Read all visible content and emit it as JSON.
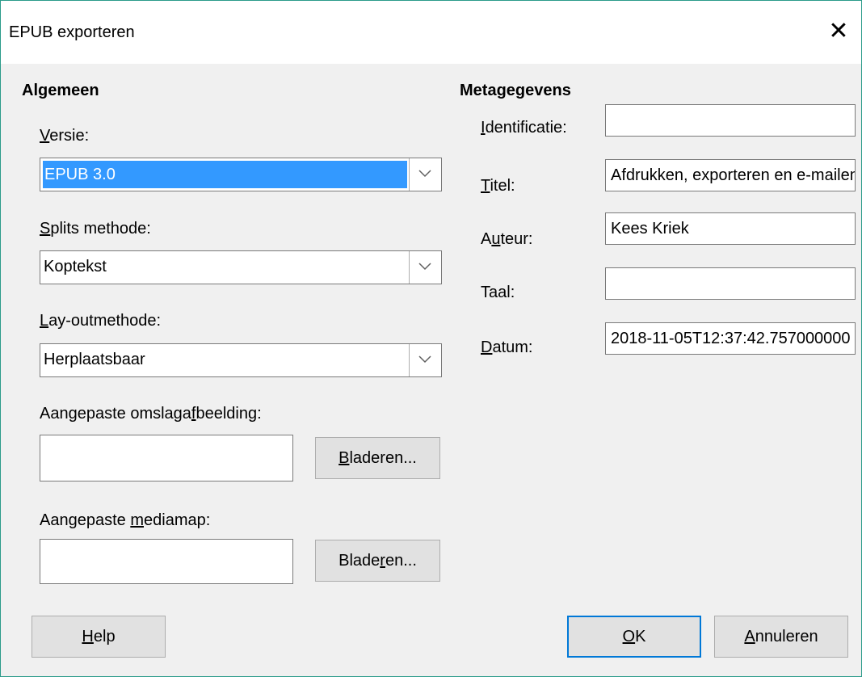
{
  "window": {
    "title": "EPUB exporteren",
    "close_glyph": "✕"
  },
  "general": {
    "heading": "Algemeen",
    "version": {
      "label_pre": "",
      "label_key": "V",
      "label_post": "ersie:",
      "value": "EPUB 3.0"
    },
    "split": {
      "label_pre": "",
      "label_key": "S",
      "label_post": "plits methode:",
      "value": "Koptekst"
    },
    "layout": {
      "label_pre": "",
      "label_key": "L",
      "label_post": "ay-outmethode:",
      "value": "Herplaatsbaar"
    },
    "cover": {
      "label_pre": "Aangepaste omslaga",
      "label_key": "f",
      "label_post": "beelding:",
      "value": "",
      "button_pre": "",
      "button_key": "B",
      "button_post": "laderen..."
    },
    "media": {
      "label_pre": "Aangepaste ",
      "label_key": "m",
      "label_post": "ediamap:",
      "value": "",
      "button_pre": "Blade",
      "button_key": "r",
      "button_post": "en..."
    }
  },
  "metadata": {
    "heading": "Metagegevens",
    "identification": {
      "label_pre": "",
      "label_key": "I",
      "label_post": "dentificatie:",
      "value": ""
    },
    "title": {
      "label_pre": "",
      "label_key": "T",
      "label_post": "itel:",
      "value": "Afdrukken, exporteren en e-mailen"
    },
    "author": {
      "label_pre": "A",
      "label_key": "u",
      "label_post": "teur:",
      "value": "Kees Kriek"
    },
    "language": {
      "label_pre": "Taal:",
      "label_key": "",
      "label_post": "",
      "value": ""
    },
    "date": {
      "label_pre": "",
      "label_key": "D",
      "label_post": "atum:",
      "value": "2018-11-05T12:37:42.757000000"
    }
  },
  "buttons": {
    "help": {
      "pre": "",
      "key": "H",
      "post": "elp"
    },
    "ok": {
      "pre": "",
      "key": "O",
      "post": "K"
    },
    "cancel": {
      "pre": "",
      "key": "A",
      "post": "nnuleren"
    }
  },
  "colors": {
    "accent": "#0078d7",
    "selection": "#3399ff",
    "window_border": "#2b9b8a"
  },
  "icons": {
    "dropdown": "chevron-down-icon",
    "close": "close-icon"
  }
}
